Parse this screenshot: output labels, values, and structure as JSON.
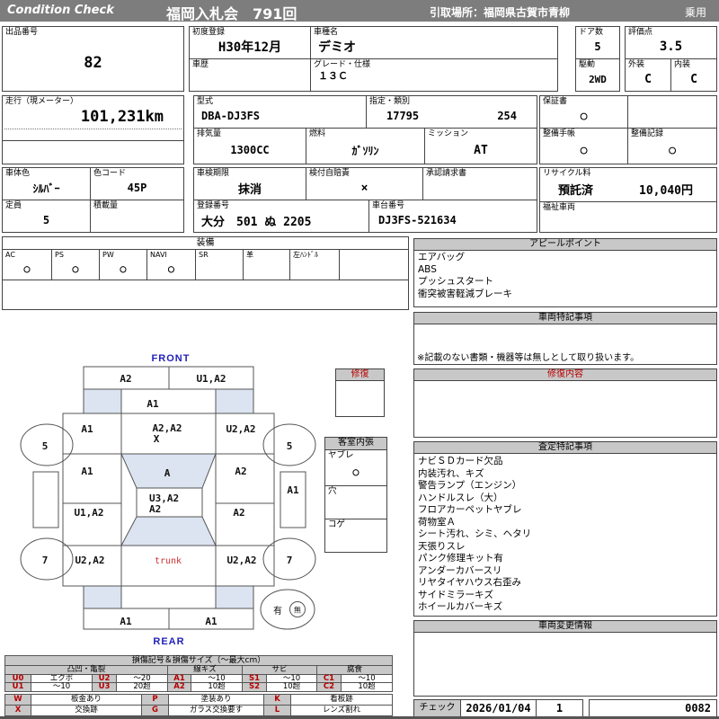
{
  "header": {
    "brand": "Condition  Check",
    "auction_title": "福岡入札会　791回",
    "pickup_location": "引取場所：福岡県古賀市青柳",
    "vehicle_category": "乗用"
  },
  "info": {
    "lot_label": "出品番号",
    "lot_number": "82",
    "first_reg_label": "初度登録",
    "first_reg": "H30年12月",
    "model_label": "車種名",
    "model_name": "デミオ",
    "history_label": "車歴",
    "history": "",
    "grade_label": "グレード・仕様",
    "grade": "１３Ｃ",
    "doors_label": "ドア数",
    "doors": "5",
    "drive_label": "駆動",
    "drive": "2WD",
    "score_label": "評価点",
    "score": "3.5",
    "exterior_label": "外装",
    "exterior_grade": "C",
    "interior_label": "内装",
    "interior_grade": "C",
    "mileage_label": "走行（現メーター）",
    "mileage": "101,231km",
    "model_code_label": "型式",
    "model_code": "DBA-DJ3FS",
    "class_label": "指定・類別",
    "class_no": "17795",
    "class_no2": "254",
    "displacement_label": "排気量",
    "displacement": "1300CC",
    "fuel_label": "燃料",
    "fuel": "ｶﾞｿﾘﾝ",
    "transmission_label": "ミッション",
    "transmission": "AT",
    "warranty_label": "保証書",
    "warranty": "○",
    "maintenance_book_label": "整備手帳",
    "maintenance_book": "○",
    "maintenance_record_label": "整備記録",
    "maintenance_record": "○",
    "body_color_label": "車体色",
    "body_color": "ｼﾙﾊﾞｰ",
    "color_code_label": "色コード",
    "color_code": "45P",
    "inspection_label": "車検期限",
    "inspection": "抹消",
    "insurance_label": "検付自賠責",
    "insurance": "×",
    "approval_label": "承認請求書",
    "approval": "",
    "capacity_label": "定員",
    "capacity": "5",
    "load_label": "積載量",
    "load": "",
    "reg_no_label": "登録番号",
    "reg_no": "大分　501 ぬ 2205",
    "chassis_label": "車台番号",
    "chassis_no": "DJ3FS-521634",
    "recycle_label": "リサイクル料",
    "recycle_status": "預託済",
    "recycle_fee": "10,040円",
    "welfare_label": "福祉車両",
    "welfare": ""
  },
  "equipment": {
    "title": "装備",
    "items": [
      {
        "label": "AC",
        "value": "○"
      },
      {
        "label": "PS",
        "value": "○"
      },
      {
        "label": "PW",
        "value": "○"
      },
      {
        "label": "NAVI",
        "value": "○"
      },
      {
        "label": "SR",
        "value": ""
      },
      {
        "label": "革",
        "value": ""
      },
      {
        "label": "左ﾊﾝﾄﾞﾙ",
        "value": ""
      },
      {
        "label": "",
        "value": ""
      }
    ]
  },
  "repair_mark": {
    "title": "修復"
  },
  "cabin_lining": {
    "title": "客室内張",
    "rows": [
      {
        "label": "ヤブレ",
        "value": "○"
      },
      {
        "label": "穴",
        "value": ""
      },
      {
        "label": "コゲ",
        "value": ""
      }
    ]
  },
  "diagram": {
    "front_label": "FRONT",
    "rear_label": "REAR",
    "trunk": "trunk",
    "front_bumper_l": "A2",
    "front_bumper_r": "U1,A2",
    "hood": "A1",
    "fender_fl": "A1",
    "cowl_a": "A2,A2",
    "cowl_b": "X",
    "fender_fr": "U2,A2",
    "door_fl": "A1",
    "windshield": "A",
    "door_fr": "A2",
    "sill_r": "A1",
    "roof_a": "U3,A2",
    "roof_b": "A2",
    "door_rl": "U1,A2",
    "door_rr": "A2",
    "fender_rl": "U2,A2",
    "fender_rr": "U2,A2",
    "rear_bumper_l": "A1",
    "rear_bumper_r": "A1",
    "wheel_fl": "5",
    "wheel_fr": "5",
    "wheel_rl": "7",
    "wheel_rr": "7",
    "spare_yes": "有",
    "spare_no": "無"
  },
  "panels": {
    "appeal_title": "アピールポイント",
    "appeal_items": [
      "エアバッグ",
      "ABS",
      "プッシュスタート",
      "衝突被害軽減ブレーキ"
    ],
    "vehicle_notes_title": "車両特記事項",
    "vehicle_notes_footnote": "※記載のない書類・機器等は無しとして取り扱います。",
    "repair_title": "修復内容",
    "assessment_title": "査定特記事項",
    "assessment_items": [
      "ナビＳＤカード欠品",
      "内装汚れ、キズ",
      "警告ランプ（エンジン）",
      "ハンドルスレ（大）",
      "フロアカーペットヤブレ",
      "荷物室Ａ",
      "シート汚れ、シミ、ヘタリ",
      "天張りスレ",
      "パンク修理キット有",
      "アンダーカバースリ",
      "リヤタイヤハウス右歪み",
      "サイドミラーキズ",
      "ホイールカバーキズ"
    ],
    "change_title": "車両変更情報",
    "check_label": "チェック",
    "check_date": "2026/01/04",
    "check_count": "1",
    "serial": "0082"
  },
  "legend": {
    "title": "損傷記号＆損傷サイズ（～最大cm）",
    "g1": "凸凹・亀裂",
    "g2": "線キズ",
    "g3": "サビ",
    "g4": "腐食",
    "r1": [
      "U0",
      "エクボ",
      "U2",
      "～20",
      "A1",
      "～10",
      "S1",
      "～10",
      "C1",
      "～10"
    ],
    "r2": [
      "U1",
      "～10",
      "U3",
      "20超",
      "A2",
      "10超",
      "S2",
      "10超",
      "C2",
      "10超"
    ],
    "x1": [
      "W",
      "板金あり",
      "P",
      "塗装あり",
      "K",
      "看板跡"
    ],
    "x2": [
      "X",
      "交換跡",
      "G",
      "ガラス交換要す",
      "L",
      "レンズ割れ"
    ]
  }
}
